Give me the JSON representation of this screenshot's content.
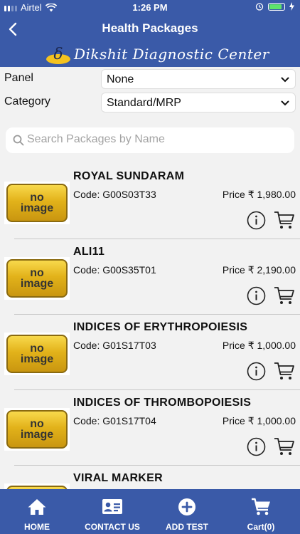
{
  "status_bar": {
    "carrier": "Airtel",
    "time": "1:26 PM"
  },
  "nav": {
    "title": "Health Packages",
    "back_icon": "chevron-left-icon"
  },
  "brand": {
    "logo_letter": "δ",
    "name": "Dikshit Diagnostic Center"
  },
  "filters": {
    "panel": {
      "label": "Panel",
      "value": "None"
    },
    "category": {
      "label": "Category",
      "value": "Standard/MRP"
    }
  },
  "search": {
    "placeholder": "Search Packages by Name",
    "value": ""
  },
  "packages": [
    {
      "name": "ROYAL SUNDARAM",
      "code": "Code:  G00S03T33",
      "price": "Price ₹ 1,980.00",
      "thumb_line1": "no",
      "thumb_line2": "image"
    },
    {
      "name": "ALI11",
      "code": "Code:  G00S35T01",
      "price": "Price ₹ 2,190.00",
      "thumb_line1": "no",
      "thumb_line2": "image"
    },
    {
      "name": "INDICES OF ERYTHROPOIESIS",
      "code": "Code:  G01S17T03",
      "price": "Price ₹ 1,000.00",
      "thumb_line1": "no",
      "thumb_line2": "image"
    },
    {
      "name": "INDICES OF THROMBOPOIESIS",
      "code": "Code:  G01S17T04",
      "price": "Price ₹ 1,000.00",
      "thumb_line1": "no",
      "thumb_line2": "image"
    },
    {
      "name": "VIRAL MARKER",
      "code": "",
      "price": "",
      "thumb_line1": "",
      "thumb_line2": ""
    }
  ],
  "tabs": [
    {
      "label": "HOME",
      "icon": "home-icon"
    },
    {
      "label": "CONTACT US",
      "icon": "contact-card-icon"
    },
    {
      "label": "ADD TEST",
      "icon": "add-circle-icon"
    },
    {
      "label": "Cart(0)",
      "icon": "cart-icon"
    }
  ],
  "colors": {
    "primary": "#3a5aa8",
    "background": "#f2f2f2",
    "thumb_gold": "#e2b21a",
    "battery": "#5ee36b"
  }
}
